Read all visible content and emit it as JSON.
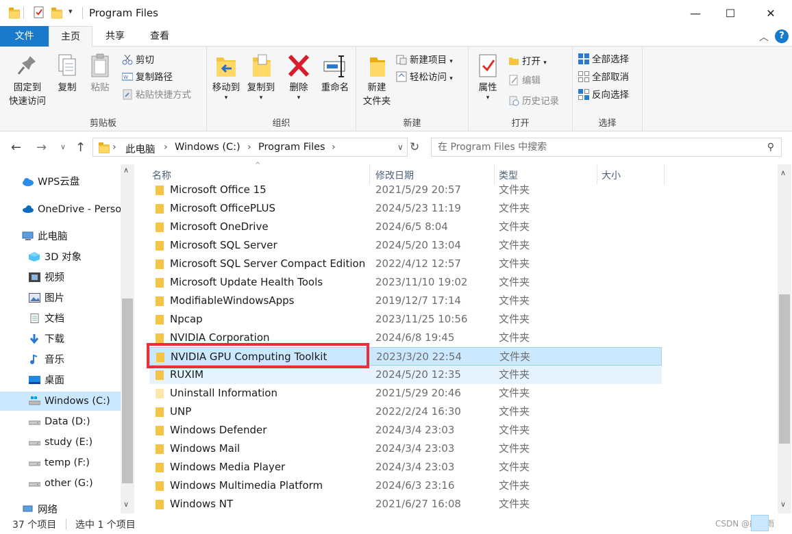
{
  "window": {
    "title": "Program Files",
    "qat_dropdown": "▾",
    "minimize": "—",
    "maximize": "☐",
    "close": "✕"
  },
  "ribbon_tabs": [
    "文件",
    "主页",
    "共享",
    "查看"
  ],
  "ribbon": {
    "clipboard": {
      "label": "剪贴板",
      "pin_line1": "固定到",
      "pin_line2": "快速访问",
      "copy": "复制",
      "paste": "粘贴",
      "cut": "剪切",
      "copy_path": "复制路径",
      "paste_shortcut": "粘贴快捷方式"
    },
    "organize": {
      "label": "组织",
      "move_to": "移动到",
      "copy_to": "复制到",
      "delete": "删除",
      "rename": "重命名"
    },
    "new": {
      "label": "新建",
      "new_folder_line1": "新建",
      "new_folder_line2": "文件夹",
      "new_item": "新建项目",
      "easy_access": "轻松访问"
    },
    "open": {
      "label": "打开",
      "properties": "属性",
      "open": "打开",
      "edit": "编辑",
      "history": "历史记录"
    },
    "select": {
      "label": "选择",
      "select_all": "全部选择",
      "select_none": "全部取消",
      "invert": "反向选择"
    }
  },
  "address": {
    "breadcrumbs": [
      "此电脑",
      "Windows (C:)",
      "Program Files"
    ],
    "search_placeholder": "在 Program Files 中搜索"
  },
  "nav_pane": [
    {
      "label": "WPS云盘",
      "icon": "cloud-icon"
    },
    {
      "label": "OneDrive - Perso",
      "icon": "onedrive-icon"
    },
    {
      "label": "此电脑",
      "icon": "computer-icon"
    },
    {
      "label": "3D 对象",
      "icon": "3d-objects-icon"
    },
    {
      "label": "视频",
      "icon": "video-icon"
    },
    {
      "label": "图片",
      "icon": "pictures-icon"
    },
    {
      "label": "文档",
      "icon": "documents-icon"
    },
    {
      "label": "下载",
      "icon": "download-icon"
    },
    {
      "label": "音乐",
      "icon": "music-icon"
    },
    {
      "label": "桌面",
      "icon": "desktop-icon"
    },
    {
      "label": "Windows (C:)",
      "icon": "drive-icon",
      "selected": true
    },
    {
      "label": "Data (D:)",
      "icon": "drive-icon"
    },
    {
      "label": "study (E:)",
      "icon": "drive-icon"
    },
    {
      "label": "temp (F:)",
      "icon": "drive-icon"
    },
    {
      "label": "other (G:)",
      "icon": "drive-icon"
    },
    {
      "label": "网络",
      "icon": "network-icon"
    }
  ],
  "columns": [
    "名称",
    "修改日期",
    "类型",
    "大小"
  ],
  "files": [
    {
      "name": "Microsoft Office 15",
      "date": "2021/5/29 20:57",
      "type": "文件夹"
    },
    {
      "name": "Microsoft OfficePLUS",
      "date": "2024/5/23 11:19",
      "type": "文件夹"
    },
    {
      "name": "Microsoft OneDrive",
      "date": "2024/6/5 8:04",
      "type": "文件夹"
    },
    {
      "name": "Microsoft SQL Server",
      "date": "2024/5/20 13:04",
      "type": "文件夹"
    },
    {
      "name": "Microsoft SQL Server Compact Edition",
      "date": "2022/4/12 12:57",
      "type": "文件夹"
    },
    {
      "name": "Microsoft Update Health Tools",
      "date": "2023/11/10 19:02",
      "type": "文件夹"
    },
    {
      "name": "ModifiableWindowsApps",
      "date": "2019/12/7 17:14",
      "type": "文件夹"
    },
    {
      "name": "Npcap",
      "date": "2023/11/25 10:56",
      "type": "文件夹"
    },
    {
      "name": "NVIDIA Corporation",
      "date": "2024/6/8 19:45",
      "type": "文件夹"
    },
    {
      "name": "NVIDIA GPU Computing Toolkit",
      "date": "2023/3/20 22:54",
      "type": "文件夹",
      "selected": true
    },
    {
      "name": "RUXIM",
      "date": "2024/5/20 12:35",
      "type": "文件夹",
      "hover": true
    },
    {
      "name": "Uninstall Information",
      "date": "2021/5/29 20:46",
      "type": "文件夹",
      "light": true
    },
    {
      "name": "UNP",
      "date": "2022/2/24 16:30",
      "type": "文件夹"
    },
    {
      "name": "Windows Defender",
      "date": "2024/3/4 23:03",
      "type": "文件夹"
    },
    {
      "name": "Windows Mail",
      "date": "2024/3/4 23:03",
      "type": "文件夹"
    },
    {
      "name": "Windows Media Player",
      "date": "2024/3/4 23:03",
      "type": "文件夹"
    },
    {
      "name": "Windows Multimedia Platform",
      "date": "2024/6/3 23:16",
      "type": "文件夹"
    },
    {
      "name": "Windows NT",
      "date": "2021/6/27 16:08",
      "type": "文件夹"
    }
  ],
  "status": {
    "item_count": "37 个项目",
    "selected": "选中 1 个项目",
    "watermark": "CSDN @能悟雨"
  },
  "colors": {
    "accent": "#1979ca",
    "selection": "#cce8ff",
    "highlight_box": "#e8303a"
  }
}
